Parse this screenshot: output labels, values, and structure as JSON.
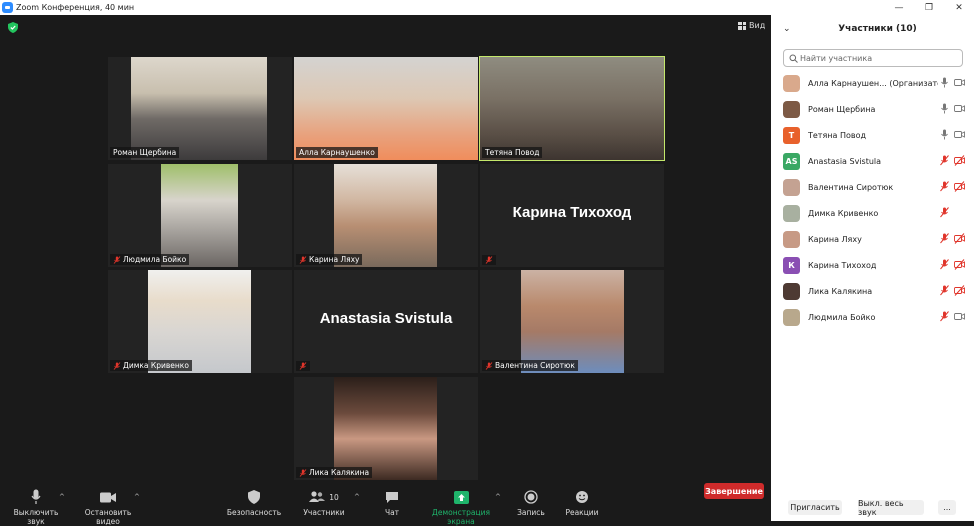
{
  "window": {
    "title": "Zoom Конференция, 40 мин"
  },
  "view_label": "Вид",
  "tiles": [
    {
      "name": "Роман Щербина",
      "muted": false,
      "photo_color": "#8f7a64"
    },
    {
      "name": "Алла Карнаушенко",
      "muted": false,
      "photo_color": "#c9a58f"
    },
    {
      "name": "Тетяна Повод",
      "muted": false,
      "photo_color": "#6d6152",
      "active": true
    },
    {
      "name": "Людмила Бойко",
      "muted": true,
      "photo_color": "#8c9b6d"
    },
    {
      "name": "Карина Ляху",
      "muted": true,
      "photo_color": "#b69680"
    },
    {
      "name": "",
      "display_name": "Карина Тихоход",
      "muted": true
    },
    {
      "name": "Димка Кривенко",
      "muted": true,
      "photo_color": "#cfd3d4"
    },
    {
      "name": "",
      "display_name": "Anastasia Svistula",
      "muted": true
    },
    {
      "name": "Валентина Сиротюк",
      "muted": true,
      "photo_color": "#b28d79"
    },
    {
      "name": "Лика Калякина",
      "muted": true,
      "photo_color": "#5a3f33"
    }
  ],
  "toolbar": {
    "mute": "Выключить звук",
    "video": "Остановить видео",
    "security": "Безопасность",
    "participants": "Участники",
    "participants_count": "10",
    "chat": "Чат",
    "share": "Демонстрация экрана",
    "record": "Запись",
    "reactions": "Реакции",
    "end": "Завершение"
  },
  "panel": {
    "title": "Участники (10)",
    "search_placeholder": "Найти участника",
    "participants": [
      {
        "name": "Алла Карнаушен... (Организатор, я)",
        "avatar": "photo",
        "color": "#d9a98c",
        "mic": "on",
        "cam": "on"
      },
      {
        "name": "Роман Щербина",
        "avatar": "photo",
        "color": "#7d5a45",
        "mic": "on",
        "cam": "on"
      },
      {
        "name": "Тетяна Повод",
        "avatar": "Т",
        "color": "#e8612c",
        "mic": "on",
        "cam": "on"
      },
      {
        "name": "Anastasia Svistula",
        "avatar": "AS",
        "color": "#3aa864",
        "mic": "off",
        "cam": "off"
      },
      {
        "name": "Валентина Сиротюк",
        "avatar": "photo",
        "color": "#c4a292",
        "mic": "off",
        "cam": "off"
      },
      {
        "name": "Димка Кривенко",
        "avatar": "photo",
        "color": "#a8b0a0",
        "mic": "off",
        "cam": "none"
      },
      {
        "name": "Карина Ляху",
        "avatar": "photo",
        "color": "#c79a85",
        "mic": "off",
        "cam": "off"
      },
      {
        "name": "Карина Тихоход",
        "avatar": "К",
        "color": "#8a4fb3",
        "mic": "off",
        "cam": "off"
      },
      {
        "name": "Лика Калякина",
        "avatar": "photo",
        "color": "#4e3a33",
        "mic": "off",
        "cam": "off"
      },
      {
        "name": "Людмила Бойко",
        "avatar": "photo",
        "color": "#b8a88c",
        "mic": "off",
        "cam": "on"
      }
    ],
    "invite": "Пригласить",
    "mute_all": "Выкл. весь звук",
    "more": "..."
  },
  "colors": {
    "accent": "#2d8cff",
    "active_speaker": "#c4e86b",
    "end": "#cf2b2b",
    "muted": "#e0352b",
    "share": "#1fb46b"
  }
}
